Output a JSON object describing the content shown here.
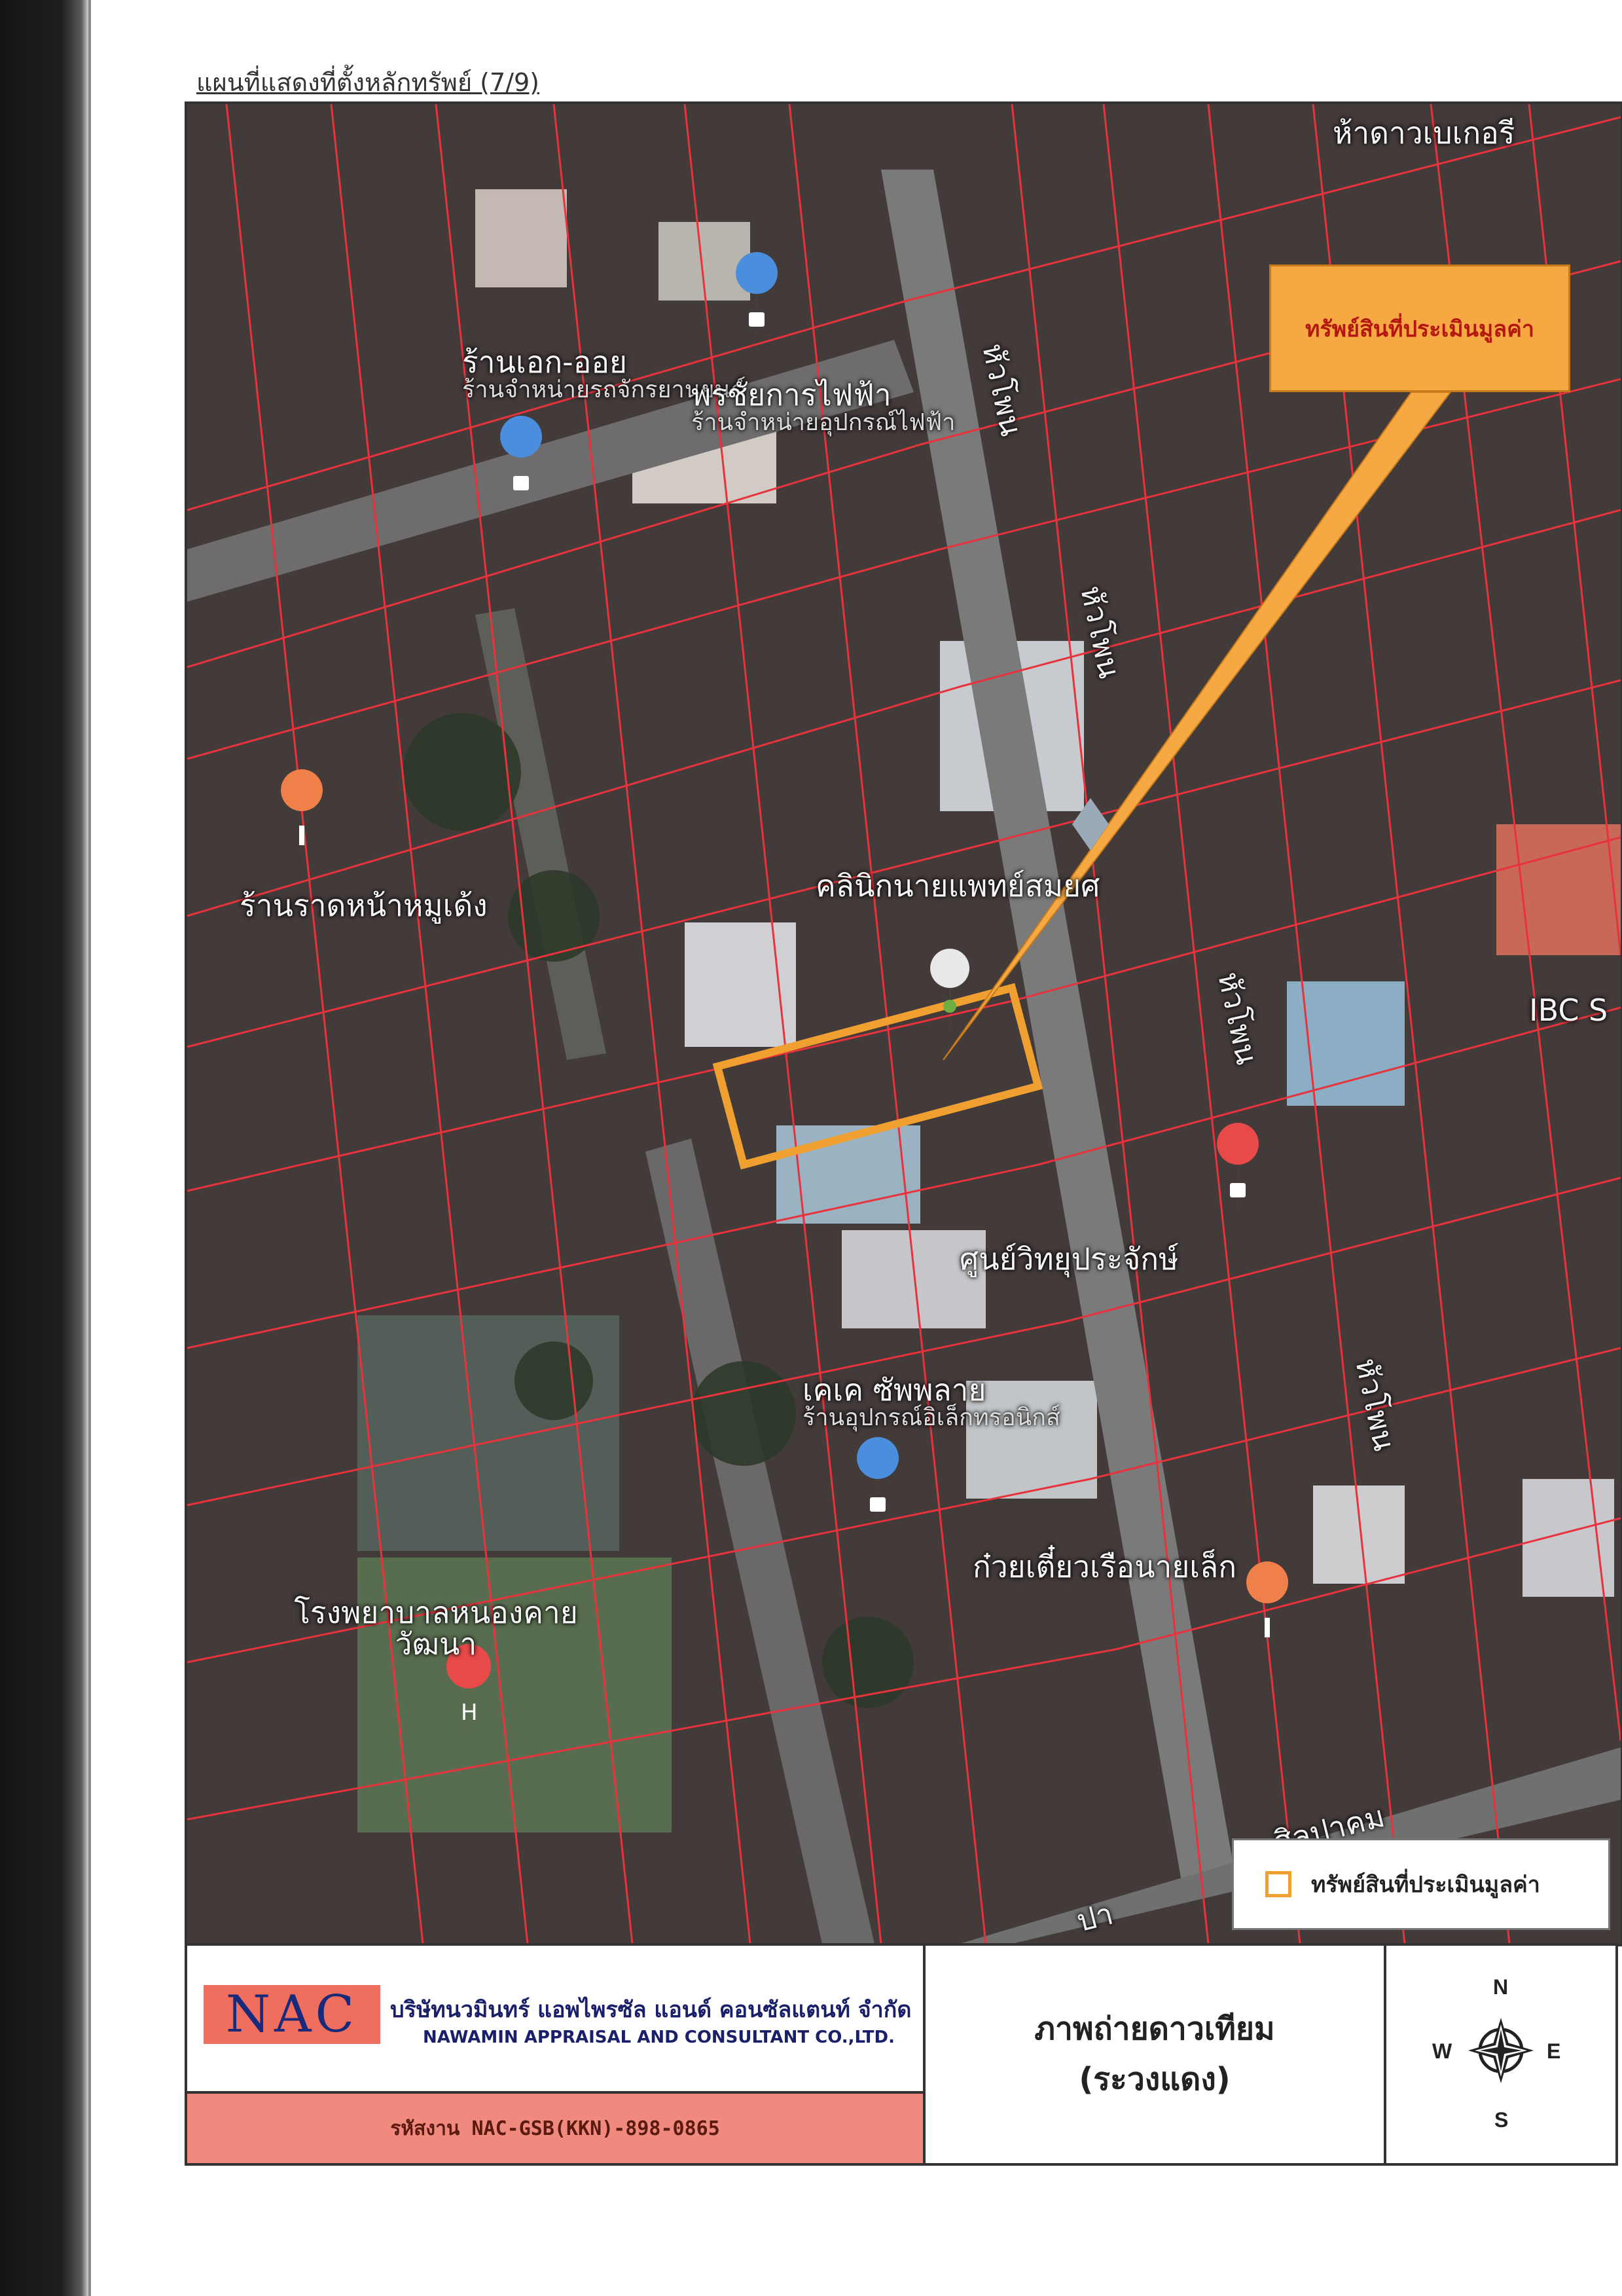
{
  "header": {
    "title": "แผนที่แสดงที่ตั้งหลักทรัพย์ (7/9)"
  },
  "map": {
    "callout_label": "ทรัพย์สินที่ประเมินมูลค่า",
    "roads": [
      {
        "id": "r1",
        "label": "หัวโพน"
      },
      {
        "id": "r2",
        "label": "หัวโพน"
      },
      {
        "id": "r3",
        "label": "หัวโพน"
      },
      {
        "id": "r4",
        "label": "หัวโพน"
      },
      {
        "id": "r5",
        "label": "ศิลปาคม"
      },
      {
        "id": "r6",
        "label": "ปา"
      }
    ],
    "pois": [
      {
        "id": "p1",
        "main": "ห้าดาวเบเกอรี",
        "sub": ""
      },
      {
        "id": "p2",
        "main": "ร้านเอก-ออย",
        "sub": "ร้านจำหน่ายรถจักรยานยนต์"
      },
      {
        "id": "p3",
        "main": "พรชัยการไฟฟ้า",
        "sub": "ร้านจำหน่ายอุปกรณ์ไฟฟ้า"
      },
      {
        "id": "p4",
        "main": "ร้านราดหน้าหมูเด้ง",
        "sub": ""
      },
      {
        "id": "p5",
        "main": "คลินิกนายแพทย์สมยศ",
        "sub": ""
      },
      {
        "id": "p6",
        "main": "IBC S",
        "sub": ""
      },
      {
        "id": "p7",
        "main": "ศูนย์วิทยุประจักษ์",
        "sub": ""
      },
      {
        "id": "p8",
        "main": "เคเค ซัพพลาย",
        "sub": "ร้านอุปกรณ์อิเล็กทรอนิกส์"
      },
      {
        "id": "p9",
        "main": "ก๋วยเตี๋ยวเรือนายเล็ก",
        "sub": ""
      },
      {
        "id": "p10",
        "main": "โรงพยาบาลหนองคายวัฒนา",
        "sub": ""
      }
    ],
    "colors": {
      "parcel_line": "#e8323c",
      "subject_outline": "#f0a030",
      "callout_fill": "#f6a842",
      "callout_text": "#b3170f"
    }
  },
  "legend": {
    "label": "ทรัพย์สินที่ประเมินมูลค่า"
  },
  "title_block": {
    "logo": "NAC",
    "company_th": "บริษัทนวมินทร์ แอพไพรซัล แอนด์ คอนซัลแตนท์ จำกัด",
    "company_en": "NAWAMIN APPRAISAL AND CONSULTANT CO.,LTD.",
    "job_code": "รหัสงาน  NAC-GSB(KKN)-898-0865",
    "map_type": "ภาพถ่ายดาวเทียม",
    "location": "(ระวงแดง)",
    "compass": {
      "n": "N",
      "s": "S",
      "e": "E",
      "w": "W"
    }
  }
}
